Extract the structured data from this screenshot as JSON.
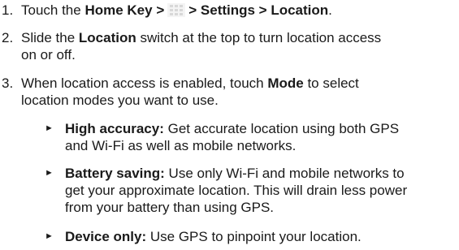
{
  "steps": [
    {
      "number": "1.",
      "prefix": "Touch the ",
      "bold1": "Home Key >",
      "icon": "apps-grid-icon",
      "bold2": "> Settings > Location",
      "suffix": "."
    },
    {
      "number": "2.",
      "line1_a": "Slide the ",
      "line1_bold": "Location",
      "line1_b": " switch at the top to turn location access",
      "line2": "on or off."
    },
    {
      "number": "3.",
      "line1_a": "When location access is enabled, touch ",
      "line1_bold": "Mode",
      "line1_b": " to select",
      "line2": "location modes you want to use."
    }
  ],
  "bullets": [
    {
      "marker": "►",
      "title": "High accuracy:",
      "line1": " Get accurate location using both GPS",
      "line2": "and Wi-Fi as well as mobile networks."
    },
    {
      "marker": "►",
      "title": "Battery saving:",
      "line1": " Use only Wi-Fi and mobile networks to",
      "line2": "get your approximate location. This will drain less power",
      "line3": "from your battery than using GPS."
    },
    {
      "marker": "►",
      "title": "Device only:",
      "line1": " Use GPS to pinpoint your location."
    }
  ]
}
